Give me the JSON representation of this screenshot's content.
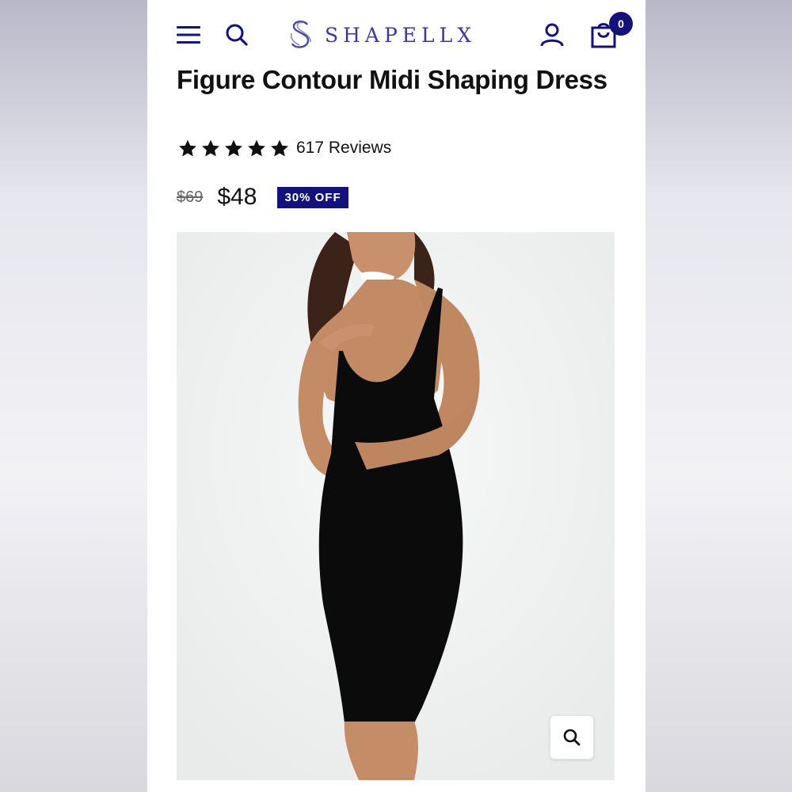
{
  "brand": {
    "name": "SHAPELLX",
    "accent_color": "#12127a"
  },
  "header": {
    "icons": [
      "menu-icon",
      "search-icon",
      "user-icon",
      "cart-icon"
    ],
    "cart_count": "0"
  },
  "product": {
    "title": "Figure Contour Midi Shaping Dress",
    "rating_stars": 5,
    "reviews": "617 Reviews",
    "old_price": "$69",
    "price": "$48",
    "discount_badge": "30% OFF"
  },
  "image": {
    "zoom_icon": "zoom-icon"
  }
}
